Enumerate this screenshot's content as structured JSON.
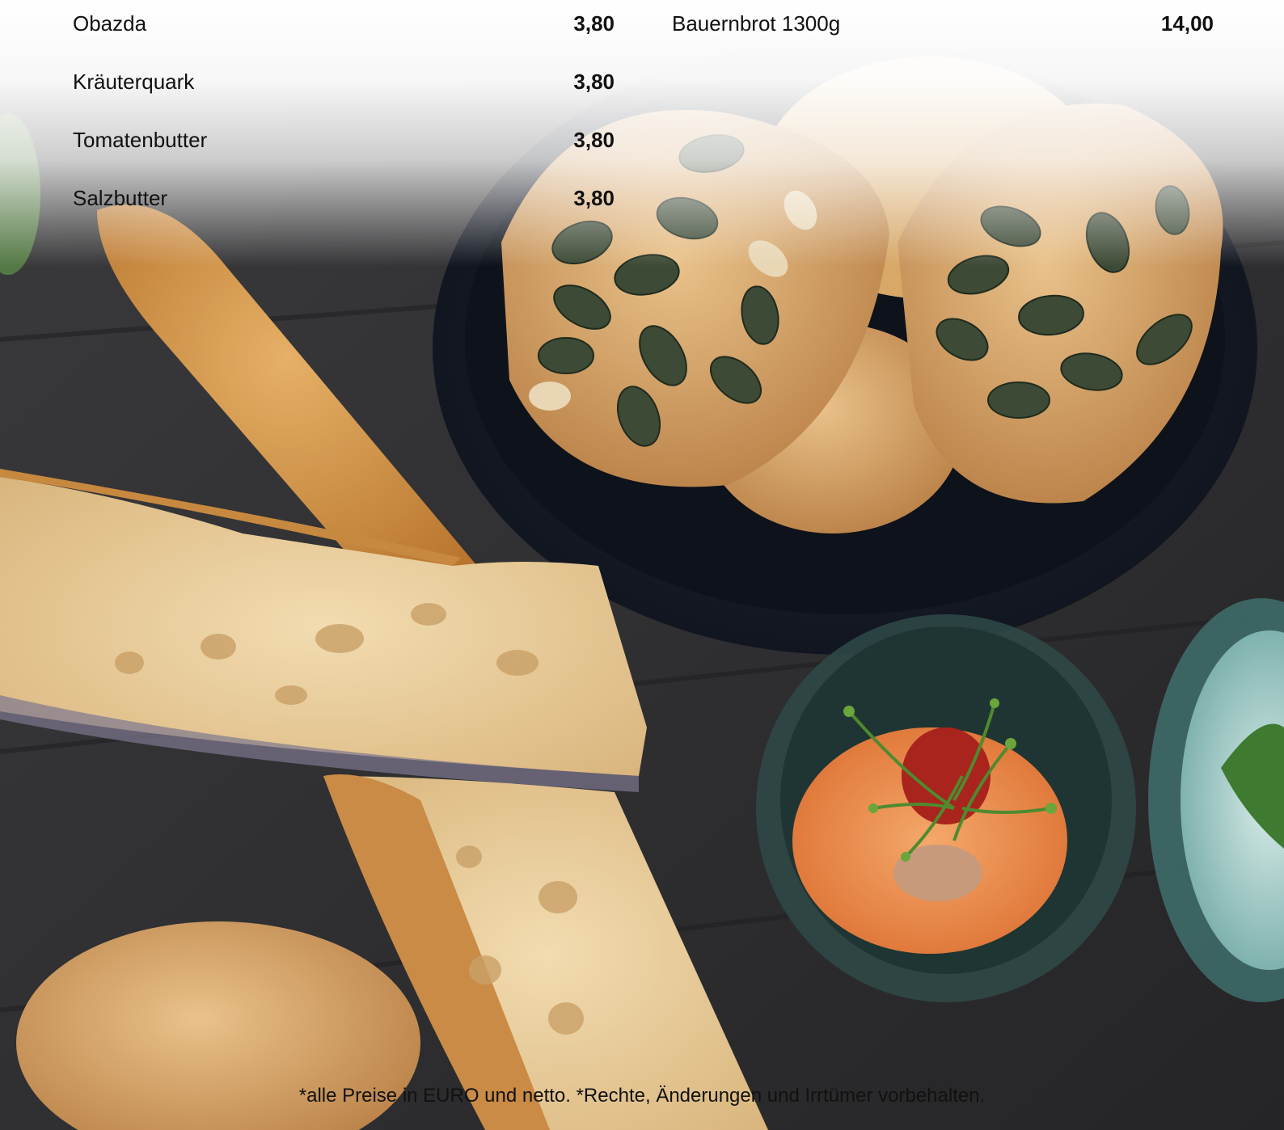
{
  "menu": {
    "left_items": [
      {
        "name": "Obazda",
        "price": "3,80"
      },
      {
        "name": "Kräuterquark",
        "price": "3,80"
      },
      {
        "name": "Tomatenbutter",
        "price": "3,80"
      },
      {
        "name": "Salzbutter",
        "price": "3,80"
      }
    ],
    "right_items": [
      {
        "name": "Bauernbrot 1300g",
        "price": "14,00"
      }
    ]
  },
  "footer": {
    "note": "*alle Preise in EURO und netto. *Rechte, Änderungen und Irrtümer vorbehalten."
  }
}
